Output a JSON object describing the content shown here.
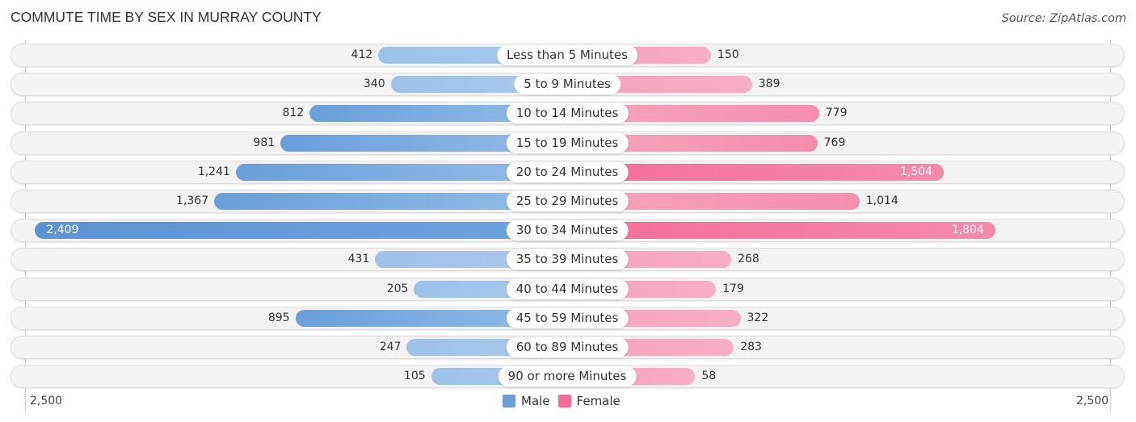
{
  "chart_data": {
    "type": "bar",
    "orientation": "horizontal-diverging",
    "title": "COMMUTE TIME BY SEX IN MURRAY COUNTY",
    "source": "Source: ZipAtlas.com",
    "categories": [
      "Less than 5 Minutes",
      "5 to 9 Minutes",
      "10 to 14 Minutes",
      "15 to 19 Minutes",
      "20 to 24 Minutes",
      "25 to 29 Minutes",
      "30 to 34 Minutes",
      "35 to 39 Minutes",
      "40 to 44 Minutes",
      "45 to 59 Minutes",
      "60 to 89 Minutes",
      "90 or more Minutes"
    ],
    "series": [
      {
        "name": "Male",
        "color": "#6a9fd9",
        "side": "left",
        "values": [
          412,
          340,
          812,
          981,
          1241,
          1367,
          2409,
          431,
          205,
          895,
          247,
          105
        ],
        "labels": [
          "412",
          "340",
          "812",
          "981",
          "1,241",
          "1,367",
          "2,409",
          "431",
          "205",
          "895",
          "247",
          "105"
        ]
      },
      {
        "name": "Female",
        "color": "#f56b98",
        "side": "right",
        "values": [
          150,
          389,
          779,
          769,
          1504,
          1014,
          1804,
          268,
          179,
          322,
          283,
          58
        ],
        "labels": [
          "150",
          "389",
          "779",
          "769",
          "1,504",
          "1,014",
          "1,804",
          "268",
          "179",
          "322",
          "283",
          "58"
        ]
      }
    ],
    "xlim": [
      -2500,
      2500
    ],
    "axis_tick_labels": {
      "left": "2,500",
      "right": "2,500"
    },
    "legend": {
      "position": "bottom-center",
      "entries": [
        "Male",
        "Female"
      ]
    },
    "grid": false
  }
}
